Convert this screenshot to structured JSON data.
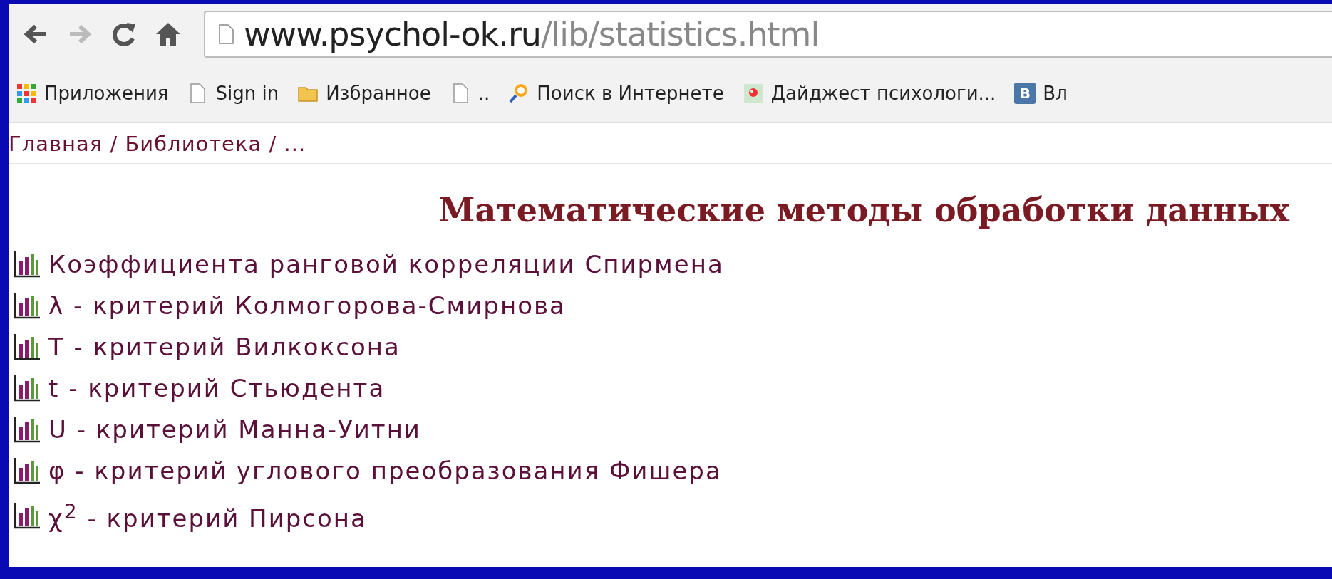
{
  "toolbar": {
    "back_disabled": false,
    "forward_disabled": true,
    "url_host": "www.psychol-ok.ru",
    "url_path": "/lib/statistics.html"
  },
  "bookmarks": [
    {
      "kind": "apps",
      "label": "Приложения"
    },
    {
      "kind": "page",
      "label": "Sign in"
    },
    {
      "kind": "folder",
      "label": "Избранное"
    },
    {
      "kind": "page",
      "label": ".."
    },
    {
      "kind": "search",
      "label": "Поиск в Интернете"
    },
    {
      "kind": "digest",
      "label": "Дайджест психологи..."
    },
    {
      "kind": "letter",
      "icon_text": "В",
      "label": "Вл"
    }
  ],
  "breadcrumb": "Главная / Библиотека / ...",
  "heading": "Математические методы обработки данных",
  "items": [
    "Коэффициента ранговой корреляции Спирмена",
    "λ - критерий Колмогорова-Смирнова",
    "T - критерий Вилкоксона",
    "t - критерий Стьюдента",
    "U - критерий Манна-Уитни",
    "φ - критерий углового преобразования Фишера",
    "χ$^{2}$ - критерий Пирсона"
  ]
}
